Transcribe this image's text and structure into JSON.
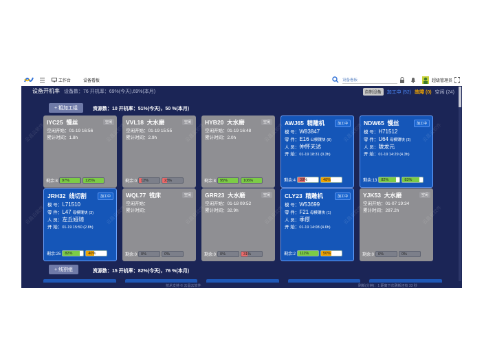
{
  "topbar": {
    "workspace_label": "工作台",
    "monitor_label": "设备看板",
    "search_placeholder": "设备看板",
    "user_label": "超级管理员"
  },
  "summary": {
    "title": "设备开机率",
    "stats": "设备数：76  开机率：69%(今天),69%(本月)"
  },
  "legend": {
    "sorted": "自制设备",
    "working": "加工中 (52)",
    "fault": "故障 (0)",
    "idle": "空闲 (24)"
  },
  "colors": {
    "working": "#4c8cff",
    "fault": "#f0a400",
    "idle": "#b5bbd4",
    "bar_green": "#7ccc46",
    "bar_red": "#e86a6a",
    "bar_orange": "#f0a400"
  },
  "groups": [
    {
      "label": "+ 粗加工组",
      "stats": "资源数：10  开机率：51%(今天)，50 %(本月)"
    },
    {
      "label": "+ 线割组",
      "stats": "资源数：15  开机率：82%(今天)，76 %(本月)"
    }
  ],
  "cards": [
    {
      "code": "IYC25",
      "type": "慢丝",
      "status": "空闲",
      "rows": [
        [
          "空闲开始：",
          "01-19 16:56"
        ],
        [
          "累计时间：",
          "1.8h"
        ]
      ],
      "remain": "剩余:8",
      "bars": [
        {
          "v": 0.97,
          "t": "97%",
          "c": "green"
        },
        {
          "v": 1.0,
          "t": "125%",
          "c": "green"
        }
      ]
    },
    {
      "code": "VVL18",
      "type": "大水磨",
      "status": "空闲",
      "rows": [
        [
          "空闲开始：",
          "01-19 15:55"
        ],
        [
          "累计时间：",
          "2.9h"
        ]
      ],
      "remain": "剩余:0",
      "bars": [
        {
          "v": 0.12,
          "t": "12%",
          "c": "red"
        },
        {
          "v": 0.23,
          "t": "23%",
          "c": "red"
        }
      ]
    },
    {
      "code": "HYB20",
      "type": "大水磨",
      "status": "空闲",
      "rows": [
        [
          "空闲开始：",
          "01-19 16:48"
        ],
        [
          "累计时间：",
          "2.0h"
        ]
      ],
      "remain": "剩余:8",
      "bars": [
        {
          "v": 0.95,
          "t": "95%",
          "c": "green"
        },
        {
          "v": 1.0,
          "t": "106%",
          "c": "green"
        }
      ]
    },
    {
      "code": "AWJ65",
      "type": "精雕机",
      "status": "加工中",
      "rows": [
        [
          "模 号：",
          "W83847"
        ],
        [
          "零 件：",
          "E16",
          "公模镶块",
          "(8)"
        ],
        [
          "人 员：",
          "仲怀天达"
        ],
        [
          "开 始：",
          "01-19 18:31 (0.3h)"
        ]
      ],
      "remain": "剩余:4",
      "bars": [
        {
          "v": 0.38,
          "t": "38%",
          "c": "red"
        },
        {
          "v": 0.48,
          "t": "48%",
          "c": "orange"
        }
      ]
    },
    {
      "code": "NDW65",
      "type": "慢丝",
      "status": "加工中",
      "rows": [
        [
          "模 号：",
          "H71512"
        ],
        [
          "零 件：",
          "U64",
          "母模镶块",
          "(3)"
        ],
        [
          "人 员：",
          "陇龙元"
        ],
        [
          "开 始：",
          "01-19 14:29 (4.3h)"
        ]
      ],
      "remain": "剩余:13",
      "bars": [
        {
          "v": 0.82,
          "t": "82%",
          "c": "green"
        },
        {
          "v": 0.83,
          "t": "83%",
          "c": "green"
        }
      ]
    },
    {
      "code": "JRH32",
      "type": "线切割",
      "status": "加工中",
      "rows": [
        [
          "模 号：",
          "L71510"
        ],
        [
          "零 件：",
          "L47",
          "母模镶块",
          "(3)"
        ],
        [
          "人 员：",
          "左丘娅琦"
        ],
        [
          "开 始：",
          "01-19 15:50 (2.8h)"
        ]
      ],
      "remain": "剩余:25",
      "bars": [
        {
          "v": 0.82,
          "t": "82%",
          "c": "green"
        },
        {
          "v": 0.4,
          "t": "40%",
          "c": "orange"
        }
      ]
    },
    {
      "code": "WQL77",
      "type": "铣床",
      "status": "空闲",
      "rows": [
        [
          "空闲开始：",
          ""
        ],
        [
          "累计时间：",
          ""
        ]
      ],
      "remain": "剩余:0",
      "bars": [
        {
          "v": 0,
          "t": "0%",
          "c": "red"
        },
        {
          "v": 0,
          "t": "0%",
          "c": "red"
        }
      ]
    },
    {
      "code": "GRR23",
      "type": "大水磨",
      "status": "空闲",
      "rows": [
        [
          "空闲开始：",
          "01-18 09:52"
        ],
        [
          "累计时间：",
          "32.9h"
        ]
      ],
      "remain": "剩余:0",
      "bars": [
        {
          "v": 0,
          "t": "0%",
          "c": "red"
        },
        {
          "v": 0.31,
          "t": "31%",
          "c": "red"
        }
      ]
    },
    {
      "code": "CLY23",
      "type": "精雕机",
      "status": "加工中",
      "rows": [
        [
          "模 号：",
          "W53699"
        ],
        [
          "零 件：",
          "F21",
          "母模镶块",
          "(1)"
        ],
        [
          "人 员：",
          "季厚"
        ],
        [
          "开 始：",
          "01-19 14:08 (4.6h)"
        ]
      ],
      "remain": "剩余:2",
      "bars": [
        {
          "v": 1.0,
          "t": "111%",
          "c": "green"
        },
        {
          "v": 0.5,
          "t": "50%",
          "c": "orange"
        }
      ]
    },
    {
      "code": "YJK53",
      "type": "大水磨",
      "status": "空闲",
      "rows": [
        [
          "空闲开始：",
          "01-07 19:34"
        ],
        [
          "累计时间：",
          "287.2h"
        ]
      ],
      "remain": "剩余:0",
      "bars": [
        {
          "v": 0,
          "t": "0%",
          "c": "red"
        },
        {
          "v": 0,
          "t": "0%",
          "c": "red"
        }
      ]
    }
  ],
  "footer": {
    "center": "技术支持 © 云昌云软件",
    "right": "刷新(分钟)：1  距离下次刷新还有 33 秒"
  },
  "watermark": "云昌云软件"
}
